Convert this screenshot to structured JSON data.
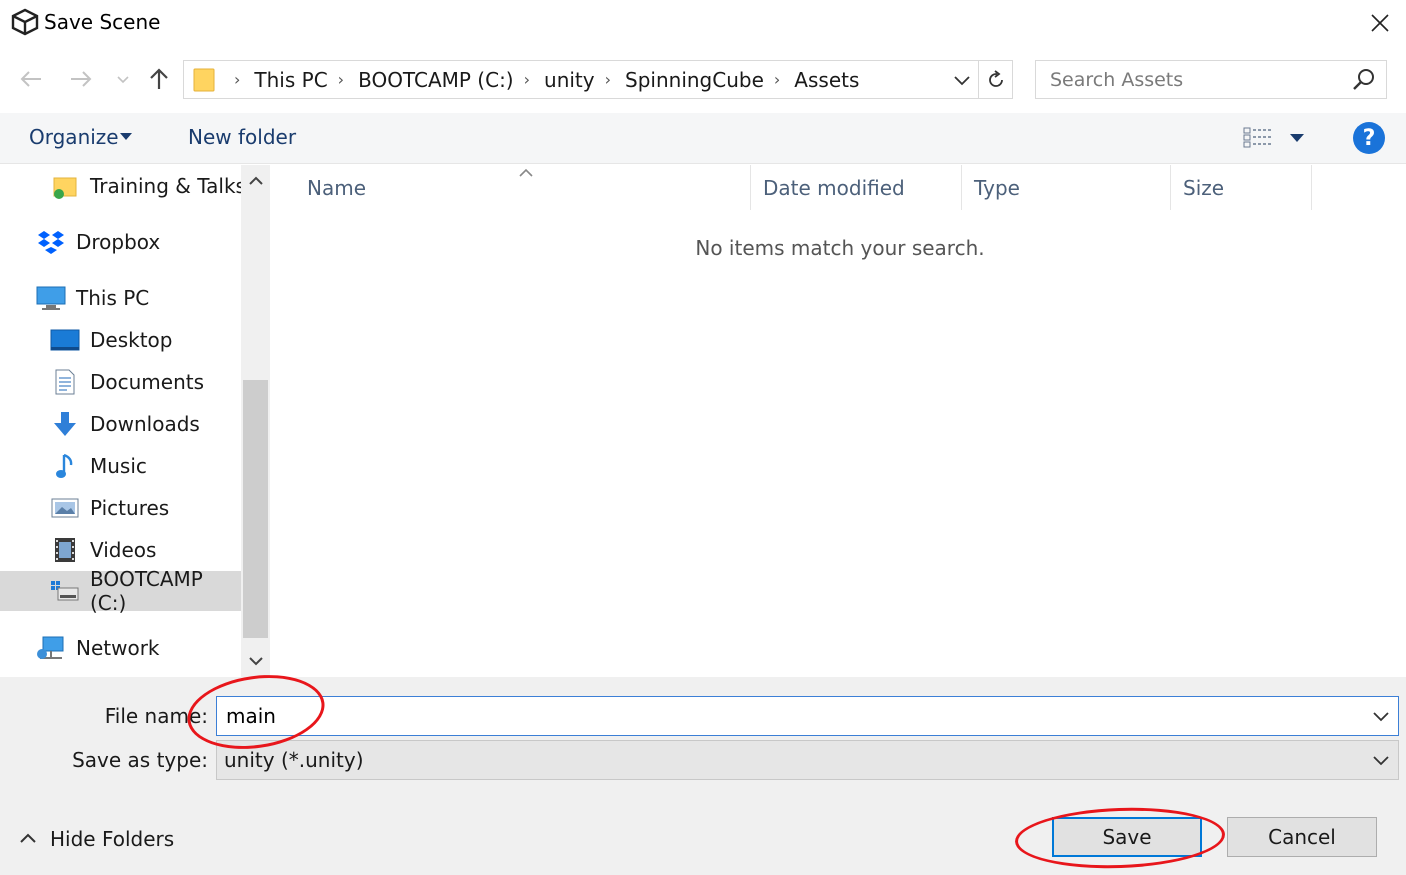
{
  "window": {
    "title": "Save Scene",
    "logo_icon": "unity-logo-icon",
    "close_icon": "close-icon"
  },
  "address_bar": {
    "breadcrumbs": [
      "This PC",
      "BOOTCAMP (C:)",
      "unity",
      "SpinningCube",
      "Assets"
    ],
    "search_placeholder": "Search Assets"
  },
  "command_bar": {
    "organize_label": "Organize",
    "new_folder_label": "New folder",
    "help_label": "?"
  },
  "nav_pane": {
    "items": [
      {
        "label": "Training & Talks",
        "icon": "shared-folder-icon",
        "level": 1
      },
      {
        "label": "Dropbox",
        "icon": "dropbox-icon",
        "level": 0
      },
      {
        "label": "This PC",
        "icon": "computer-icon",
        "level": 0
      },
      {
        "label": "Desktop",
        "icon": "desktop-icon",
        "level": 1
      },
      {
        "label": "Documents",
        "icon": "documents-icon",
        "level": 1
      },
      {
        "label": "Downloads",
        "icon": "downloads-icon",
        "level": 1
      },
      {
        "label": "Music",
        "icon": "music-icon",
        "level": 1
      },
      {
        "label": "Pictures",
        "icon": "pictures-icon",
        "level": 1
      },
      {
        "label": "Videos",
        "icon": "videos-icon",
        "level": 1
      },
      {
        "label": "BOOTCAMP (C:)",
        "icon": "drive-icon",
        "level": 1,
        "selected": true
      },
      {
        "label": "Network",
        "icon": "network-icon",
        "level": 0
      }
    ]
  },
  "file_list": {
    "columns": [
      "Name",
      "Date modified",
      "Type",
      "Size"
    ],
    "empty_message": "No items match your search."
  },
  "form": {
    "file_name_label": "File name:",
    "file_name_value": "main",
    "save_as_type_label": "Save as type:",
    "save_as_type_value": "unity (*.unity)"
  },
  "footer": {
    "hide_folders_label": "Hide Folders",
    "save_label": "Save",
    "cancel_label": "Cancel"
  },
  "colors": {
    "accent": "#0078d7",
    "annotation": "#e8161b",
    "command_text": "#1a3c6e"
  }
}
